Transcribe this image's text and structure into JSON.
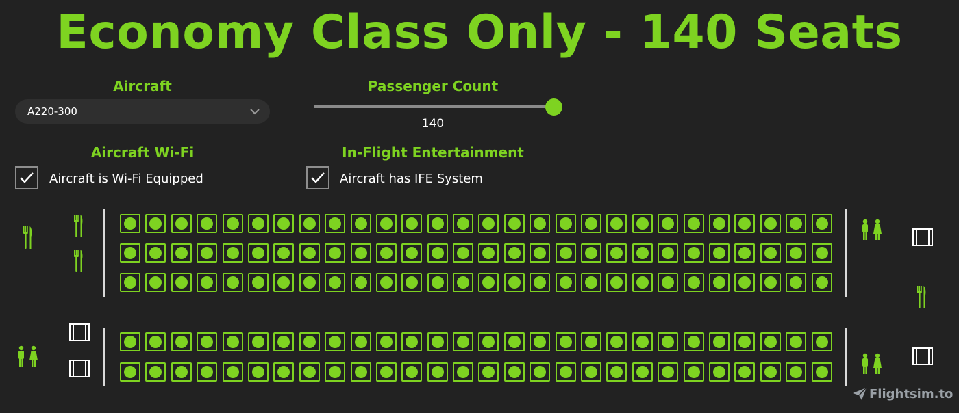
{
  "title": "Economy Class Only - 140 Seats",
  "aircraft": {
    "label": "Aircraft",
    "selected": "A220-300"
  },
  "passenger_count": {
    "label": "Passenger Count",
    "value": "140",
    "fraction": 1.0
  },
  "wifi": {
    "label": "Aircraft Wi-Fi",
    "checkbox_label": "Aircraft is Wi-Fi Equipped",
    "checked": true
  },
  "ife": {
    "label": "In-Flight Entertainment",
    "checkbox_label": "Aircraft has IFE System",
    "checked": true
  },
  "seat_map": {
    "columns": 28,
    "upper_rows": 3,
    "lower_rows": 2,
    "seat_state": "occupied"
  },
  "colors": {
    "accent": "#7ed321",
    "background": "#222222",
    "wall": "#d9d9d9"
  },
  "icons": {
    "galley": "fork-knife-icon",
    "lavatory": "lavatory-icon",
    "door": "door-icon",
    "chevron": "chevron-down-icon",
    "check": "checkmark-icon",
    "brand": "paper-plane-icon"
  },
  "brand": "Flightsim.to"
}
